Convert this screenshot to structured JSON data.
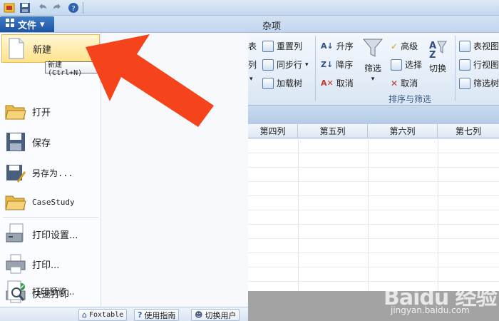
{
  "quick_access": {
    "icons": [
      "app-icon",
      "save-icon",
      "undo-icon",
      "redo-icon",
      "help-icon"
    ]
  },
  "ribbon": {
    "file_tab": "文件",
    "tab_misc": "杂项",
    "buttons": {
      "biao": "表",
      "lie": "列",
      "reset_col": "重置列",
      "sync_row": "同步行",
      "load_tree": "加载树",
      "asc": "升序",
      "desc": "降序",
      "cancel1": "取消",
      "filter": "筛选",
      "advanced": "高级",
      "select": "选择",
      "cancel2": "取消",
      "switch": "切换",
      "table_view": "表视图",
      "row_view": "行视图",
      "filter_tree": "筛选树"
    },
    "group_sort_filter": "排序与筛选"
  },
  "sheet": {
    "columns": [
      "第四列",
      "第五列",
      "第六列",
      "第七列"
    ]
  },
  "file_menu": {
    "items": [
      {
        "label": "新建",
        "icon": "new-file-icon"
      },
      {
        "label": "打开",
        "icon": "folder-open-icon"
      },
      {
        "label": "保存",
        "icon": "save-icon"
      },
      {
        "label": "另存为...",
        "icon": "save-as-icon"
      },
      {
        "label": "CaseStudy",
        "icon": "folder-icon"
      },
      {
        "label": "打印设置...",
        "icon": "print-settings-icon"
      },
      {
        "label": "打印...",
        "icon": "printer-icon"
      },
      {
        "label": "快速打印",
        "icon": "quick-print-icon"
      },
      {
        "label": "打印预览...",
        "icon": "print-preview-icon"
      }
    ],
    "tooltip": "新建 (Ctrl+N)",
    "footer": {
      "foxtable": "Foxtable",
      "guide": "使用指南",
      "switch_user": "切换用户"
    }
  },
  "colors": {
    "accent": "#1c54a3",
    "arrow": "#f5441c",
    "highlight": "#ffe28a"
  },
  "watermark": {
    "brand": "Baidu 经验",
    "url": "jingyan.baidu.com"
  }
}
